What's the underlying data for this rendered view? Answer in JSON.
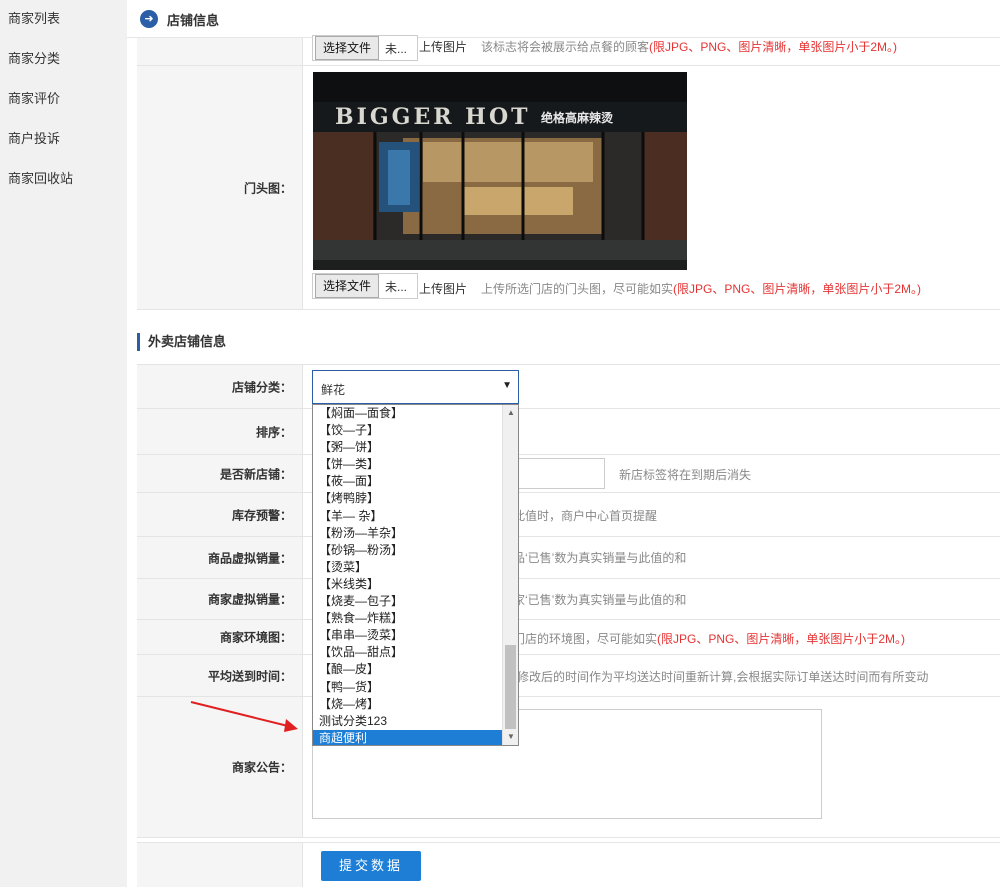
{
  "sidebar": {
    "items": [
      {
        "label": "商家列表"
      },
      {
        "label": "商家分类"
      },
      {
        "label": "商家评价"
      },
      {
        "label": "商户投诉"
      },
      {
        "label": "商家回收站"
      }
    ]
  },
  "header": {
    "title": "店铺信息",
    "icon": "arrow-right-circle-icon"
  },
  "logo_row": {
    "file_button": "选择文件",
    "file_status": "未...",
    "upload_label": "上传图片",
    "tip_gray": "该标志将会被展示给点餐的顾客",
    "tip_red": "(限JPG、PNG、图片清晰，单张图片小于2M。)"
  },
  "storefront_row": {
    "label": "门头图：",
    "image_sign": "BIGGER HOT",
    "image_sign_cn": "绝格高麻辣烫",
    "file_button": "选择文件",
    "file_status": "未...",
    "upload_label": "上传图片",
    "tip_gray": "上传所选门店的门头图，尽可能如实",
    "tip_red": "(限JPG、PNG、图片清晰，单张图片小于2M。)"
  },
  "section_title": "外卖店铺信息",
  "category_row": {
    "label": "店铺分类：",
    "selected": "鲜花"
  },
  "dropdown": {
    "options": [
      "【焖面—面食】",
      "【饺—子】",
      "【粥—饼】",
      "【饼—类】",
      "【莜—面】",
      "【烤鸭脖】",
      "【羊— 杂】",
      "【粉汤—羊杂】",
      "【砂锅—粉汤】",
      "【烫菜】",
      "【米线类】",
      "【烧麦—包子】",
      "【熟食—炸糕】",
      "【串串—烫菜】",
      "【饮品—甜点】",
      "【酿—皮】",
      "【鸭—货】",
      "【烧—烤】",
      "测试分类123",
      "商超便利"
    ],
    "selected_index": 19
  },
  "sort_row": {
    "label": "排序："
  },
  "new_store_row": {
    "label": "是否新店铺：",
    "tip": "新店标签将在到期后消失"
  },
  "stock_row": {
    "label": "库存预警：",
    "tip": "此值时，商户中心首页提醒"
  },
  "goods_sales_row": {
    "label": "商品虚拟销量：",
    "tip": "品‘已售’数为真实销量与此值的和"
  },
  "store_sales_row": {
    "label": "商家虚拟销量：",
    "tip": "家‘已售’数为真实销量与此值的和"
  },
  "env_row": {
    "label": "商家环境图：",
    "tip_gray": "门店的环境图，尽可能如实",
    "tip_red": "(限JPG、PNG、图片清晰，单张图片小于2M。)"
  },
  "delivery_row": {
    "label": "平均送到时间：",
    "tip": "修改后的时间作为平均送达时间重新计算,会根据实际订单送达时间而有所变动"
  },
  "notice_row": {
    "label": "商家公告："
  },
  "submit": {
    "label": "提交数据"
  },
  "colors": {
    "accent": "#1e7ed6",
    "header_icon": "#2a5fa8",
    "warning": "#e53333",
    "arrow": "#e02020"
  }
}
